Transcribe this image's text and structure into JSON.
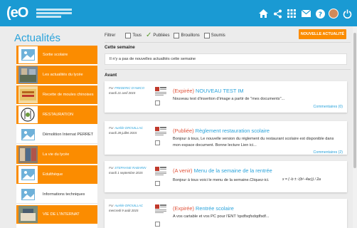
{
  "header": {
    "logo_text": "(eO",
    "logo_tagline": "Environnement Numérique de Travail",
    "icons": [
      "home-icon",
      "share-icon",
      "apps-grid-icon",
      "mail-icon",
      "help-icon",
      "avatar",
      "power-icon"
    ]
  },
  "page": {
    "title": "Actualités"
  },
  "sidebar": {
    "items": [
      {
        "label": "Sortie scolaire",
        "style": "orange",
        "thumb": "placeholder"
      },
      {
        "label": "Les actualités du lycée",
        "style": "orange",
        "thumb": "photo"
      },
      {
        "label": "Recette de moules chinoises",
        "style": "orange",
        "thumb": "photo"
      },
      {
        "label": "RESTAURATION",
        "style": "orange",
        "thumb": "drawing"
      },
      {
        "label": "Démolition Internat PERRET",
        "style": "white",
        "thumb": "placeholder"
      },
      {
        "label": "La vie du lycée",
        "style": "orange",
        "thumb": "photo"
      },
      {
        "label": "Edulthèque",
        "style": "orange",
        "thumb": "placeholder"
      },
      {
        "label": "Informations techniques",
        "style": "white",
        "thumb": "placeholder"
      },
      {
        "label": "VIE DE L'INTERNAT",
        "style": "orange",
        "thumb": "photo"
      }
    ]
  },
  "filters": {
    "label": "Filtrer",
    "options": [
      {
        "label": "Tous",
        "checked": false
      },
      {
        "label": "Publiées",
        "checked": true
      },
      {
        "label": "Brouillons",
        "checked": false
      },
      {
        "label": "Soumis",
        "checked": false
      }
    ]
  },
  "new_button": "NOUVELLE ACTUALITÉ",
  "this_week": {
    "heading": "Cette semaine",
    "empty_message": "Il n'y a pas de nouvelles actualités cette semaine"
  },
  "before": {
    "heading": "Avant"
  },
  "cards": [
    {
      "by_prefix": "Par",
      "author": "FREDERIC D'AMICO",
      "date": "mardi 21 avril 2015",
      "status": "(Expirée)",
      "title": "NOUVEAU TEST IM",
      "body": "Nouveau test d'insertion d'image a partir de \"mes documents\"...",
      "comments": "Commentaires (0)"
    },
    {
      "by_prefix": "Par",
      "author": "Aurélie DROUILLAC",
      "date": "mardi 28 juillet 2015",
      "status": "(Publiée)",
      "title": "Règlement restauration scolaire",
      "body": "Bonjour à tous, Le nouvelle version du règlement du restaurant scolaire est disponible dans mon espace document. Bonne lecture Lien ici...",
      "comments": "Commentaires (2)"
    },
    {
      "by_prefix": "Par",
      "author": "STEPHANE RABARIN",
      "date": "mardi 1 septembre 2015",
      "status": "(A venir)",
      "title": "Menu de la semaine de la rentrée",
      "body": "Bonjour à tous voici le menu de la semaine.Cliquez-ici.",
      "formula": "x = (−b ± √(b²−4ac)) / 2a",
      "body_tail": "...",
      "comments": ""
    },
    {
      "by_prefix": "Par",
      "author": "Aurélie DROUILLAC",
      "date": "mercredi 9 août 2015",
      "status": "(Expirée)",
      "title": "Rentrée scolaire",
      "body": "A vos cartable et vos PC pour l'ENT !qsdfsqfsdqdfsdf...",
      "comments": ""
    }
  ],
  "colors": {
    "brand_blue": "#1a9ad3",
    "accent_orange": "#fb8c00",
    "status_red": "#e0533b",
    "link_blue": "#2aa3db"
  }
}
